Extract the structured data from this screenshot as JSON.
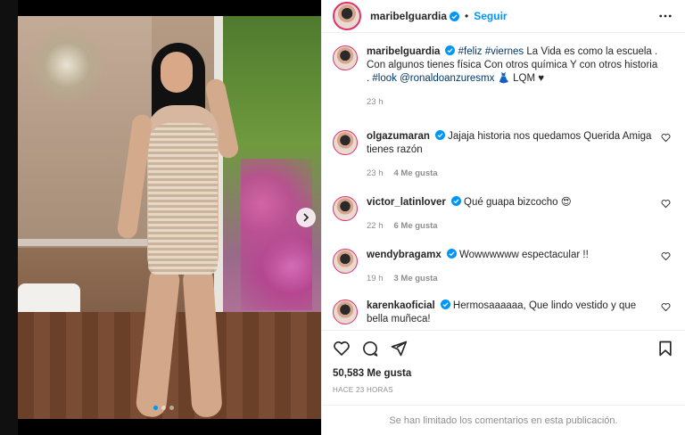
{
  "post": {
    "username": "maribelguardia",
    "follow_separator": "•",
    "follow_label": "Seguir",
    "media_dots": 3,
    "active_dot": 0
  },
  "caption": {
    "username": "maribelguardia",
    "text_parts": [
      "#feliz",
      "#viernes",
      "La Vida es como la escuela . Con algunos tienes física Con otros química Y con otros historia .",
      "#look",
      "@ronaldoanzuresmx",
      "👗",
      "LQM",
      "♥"
    ],
    "time": "23 h"
  },
  "comments": [
    {
      "username": "olgazumaran",
      "text": "Jajaja historia nos quedamos Querida Amiga tienes razón",
      "time": "23 h",
      "likes": "4 Me gusta"
    },
    {
      "username": "victor_latinlover",
      "text": "Qué guapa bizcocho 😍",
      "time": "22 h",
      "likes": "6 Me gusta"
    },
    {
      "username": "wendybragamx",
      "text": "Wowwwwww espectacular !!",
      "time": "19 h",
      "likes": "3 Me gusta"
    },
    {
      "username": "karenkaoficial",
      "text": "Hermosaaaaaa, Que lindo vestido y que bella muñeca!",
      "time": "",
      "likes": ""
    }
  ],
  "footer": {
    "likes": "50,583 Me gusta",
    "posted": "HACE 23 HORAS",
    "comments_limited": "Se han limitado los comentarios en esta publicación."
  },
  "colors": {
    "link": "#00376b",
    "follow": "#0095f6",
    "verified": "#0095f6",
    "muted": "#8e8e8e"
  }
}
